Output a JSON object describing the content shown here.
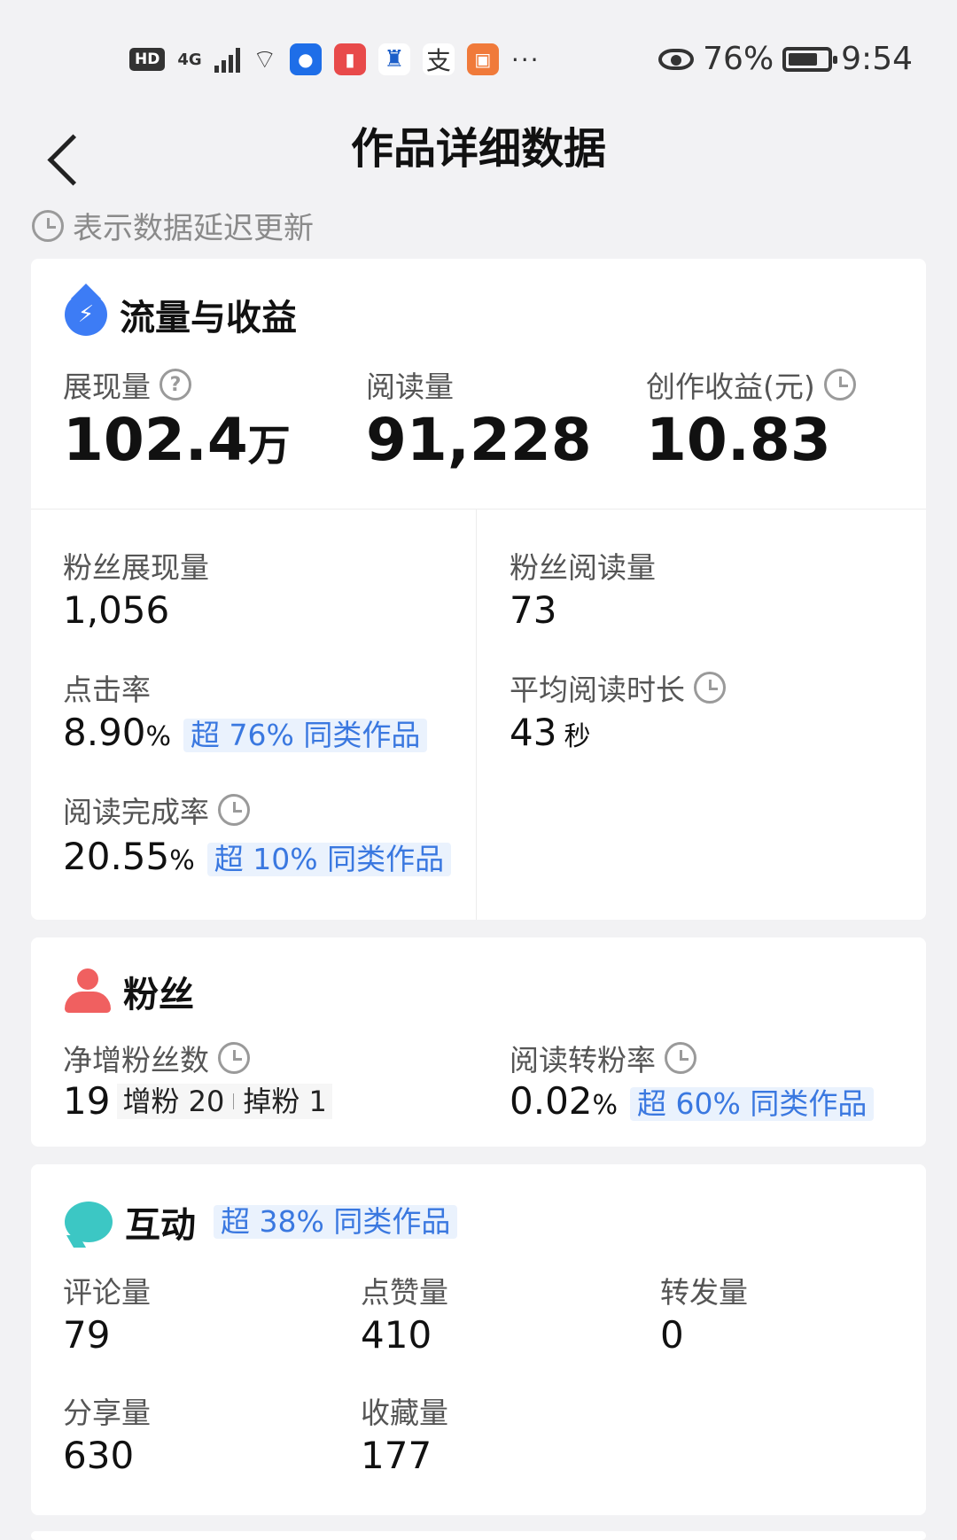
{
  "status_bar": {
    "hd": "HD",
    "network": "4G",
    "apps": [
      {
        "name": "bulb-app-icon",
        "glyph": "💡",
        "color": "#1e6ee8"
      },
      {
        "name": "book-app-icon",
        "glyph": "📖",
        "color": "#e84a4a"
      },
      {
        "name": "castle-app-icon",
        "glyph": "♜",
        "color": "#1d5fc9"
      },
      {
        "name": "alipay-app-icon",
        "glyph": "支",
        "color": "#ffffff"
      },
      {
        "name": "video-app-icon",
        "glyph": "▣",
        "color": "#f07a3a"
      }
    ],
    "more": "···",
    "battery_text": "76%",
    "time": "9:54"
  },
  "header": {
    "title": "作品详细数据",
    "delay_note": "表示数据延迟更新"
  },
  "traffic": {
    "title": "流量与收益",
    "impressions_label": "展现量",
    "impressions_value": "102.4",
    "impressions_unit": "万",
    "reads_label": "阅读量",
    "reads_value": "91,228",
    "income_label": "创作收益(元)",
    "income_value": "10.83",
    "fan_impressions_label": "粉丝展现量",
    "fan_impressions_value": "1,056",
    "fan_reads_label": "粉丝阅读量",
    "fan_reads_value": "73",
    "ctr_label": "点击率",
    "ctr_value": "8.90",
    "ctr_unit": "%",
    "ctr_tag": "超 76% 同类作品",
    "avg_read_label": "平均阅读时长",
    "avg_read_value": "43",
    "avg_read_unit": "秒",
    "completion_label": "阅读完成率",
    "completion_value": "20.55",
    "completion_unit": "%",
    "completion_tag": "超 10% 同类作品"
  },
  "fans": {
    "title": "粉丝",
    "net_label": "净增粉丝数",
    "net_value": "19",
    "gain_text": "增粉 20",
    "loss_text": "掉粉 1",
    "conv_label": "阅读转粉率",
    "conv_value": "0.02",
    "conv_unit": "%",
    "conv_tag": "超 60% 同类作品"
  },
  "interaction": {
    "title": "互动",
    "tag": "超 38% 同类作品",
    "comments_label": "评论量",
    "comments_value": "79",
    "likes_label": "点赞量",
    "likes_value": "410",
    "forwards_label": "转发量",
    "forwards_value": "0",
    "shares_label": "分享量",
    "shares_value": "630",
    "favorites_label": "收藏量",
    "favorites_value": "177"
  }
}
